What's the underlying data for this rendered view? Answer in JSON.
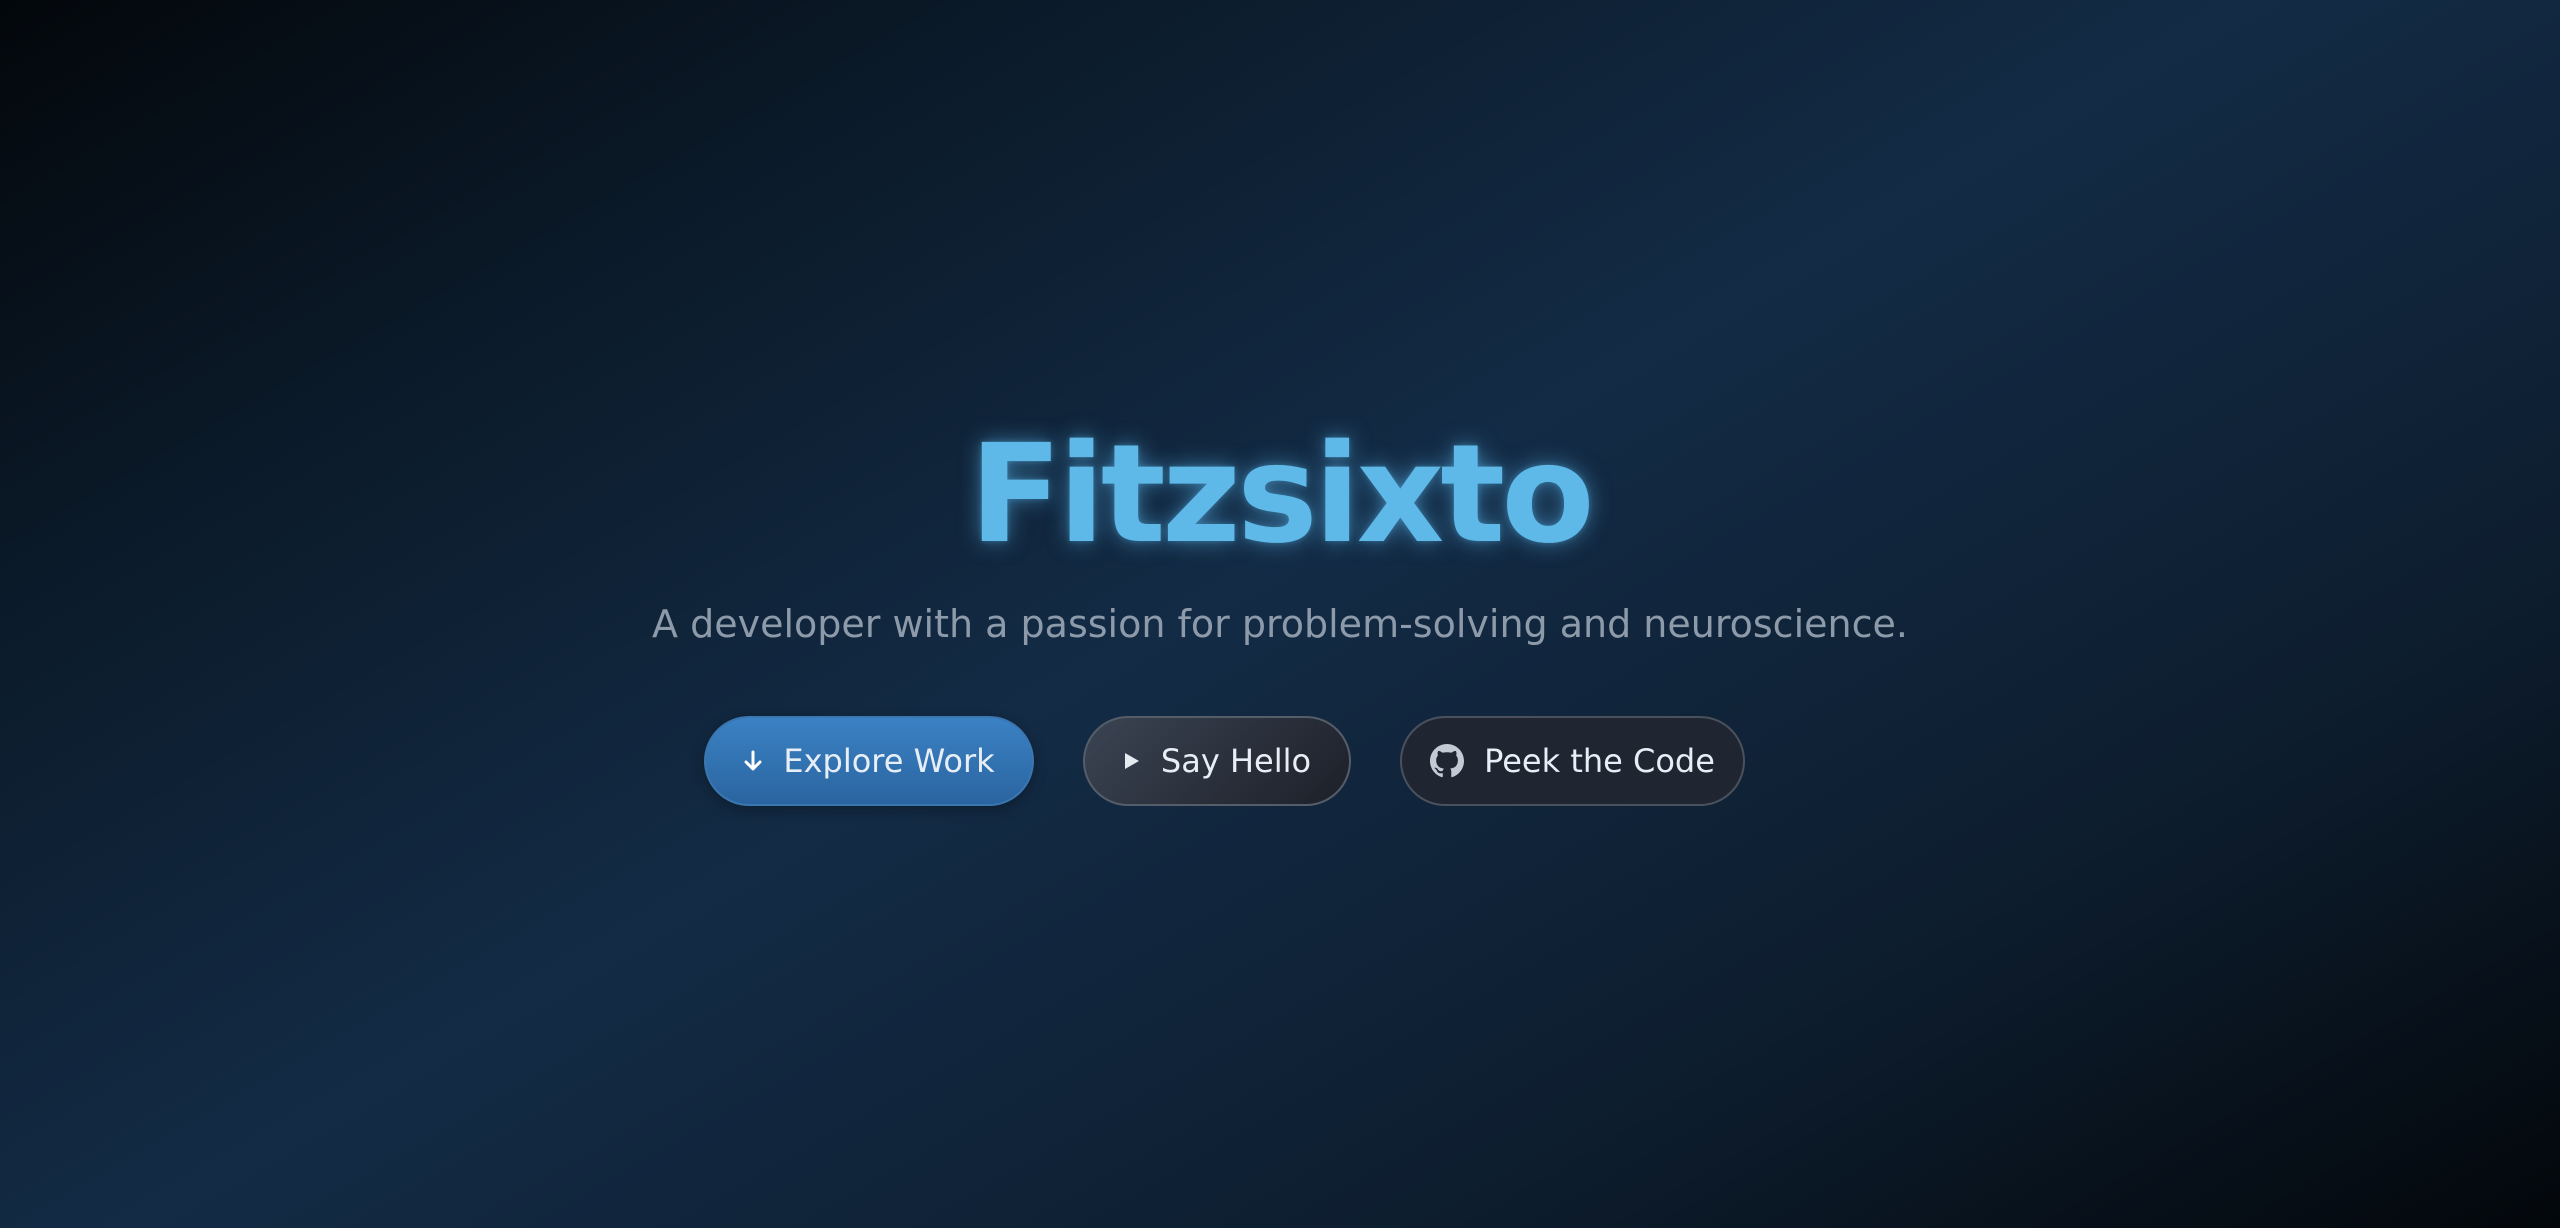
{
  "hero": {
    "title": "Fitzsixto",
    "subtitle": "A developer with a passion for problem-solving and neuroscience."
  },
  "actions": {
    "explore": {
      "label": "Explore Work",
      "icon": "arrow-down-icon"
    },
    "hello": {
      "label": "Say Hello",
      "icon": "play-icon"
    },
    "code": {
      "label": "Peek the Code",
      "icon": "github-icon"
    }
  },
  "colors": {
    "title": "#5fb9e8",
    "primary_button": "#3b82c4",
    "background_dark": "#03070b",
    "background_accent": "#132b45",
    "subtitle": "#8d9aaa"
  }
}
